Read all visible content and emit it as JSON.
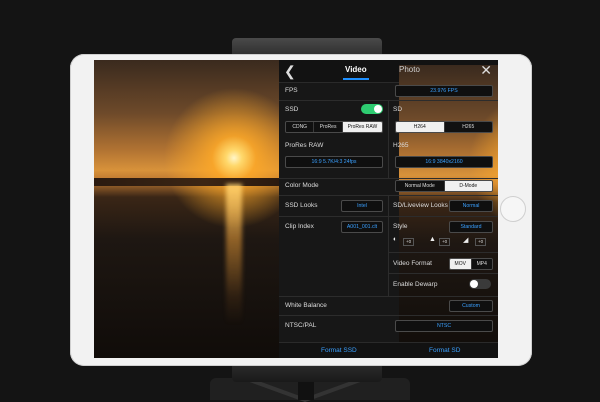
{
  "header": {
    "tabs": [
      {
        "label": "Video",
        "active": true
      },
      {
        "label": "Photo",
        "active": false
      }
    ]
  },
  "icons": {
    "back": "chevron-left-icon",
    "close": "close-icon"
  },
  "fps": {
    "label": "FPS",
    "value": "23.976 FPS"
  },
  "ssd": {
    "label": "SSD",
    "enabled": true,
    "options": [
      "CDNG",
      "ProRes",
      "ProRes RAW"
    ],
    "selected": "ProRes RAW"
  },
  "sd": {
    "label": "SD",
    "options": [
      "H264",
      "H265"
    ],
    "selected": "H264"
  },
  "prores_raw": {
    "label": "ProRes RAW",
    "value": "16:9 5.7K/4:3 24fps"
  },
  "h265": {
    "label": "H265",
    "value": "16:9 3840x2160"
  },
  "color_mode": {
    "label": "Color Mode",
    "options": [
      "Normal Mode",
      "D-Mode"
    ],
    "selected": "D-Mode"
  },
  "ssd_looks": {
    "label": "SSD Looks",
    "value": "Intel"
  },
  "sd_liveview_looks": {
    "label": "SD/Liveview Looks",
    "value": "Normal"
  },
  "clip_index": {
    "label": "Clip Index",
    "value": "A001_001.clt"
  },
  "style": {
    "label": "Style",
    "value": "Standard",
    "params": [
      {
        "icon": "contrast-icon",
        "value": "+0"
      },
      {
        "icon": "sharpness-icon",
        "value": "+0"
      },
      {
        "icon": "saturation-icon",
        "value": "+0"
      }
    ]
  },
  "video_format": {
    "label": "Video Format",
    "options": [
      "MOV",
      "MP4"
    ],
    "selected": "MOV"
  },
  "enable_dewarp": {
    "label": "Enable Dewarp",
    "enabled": false
  },
  "white_balance": {
    "label": "White Balance",
    "value": "Custom"
  },
  "ntsc_pal": {
    "label": "NTSC/PAL",
    "value": "NTSC"
  },
  "footer": {
    "format_ssd": "Format SSD",
    "format_sd": "Format SD"
  },
  "colors": {
    "accent": "#1e90ff",
    "toggle_on": "#2ecc71",
    "panel_bg": "#171717"
  }
}
